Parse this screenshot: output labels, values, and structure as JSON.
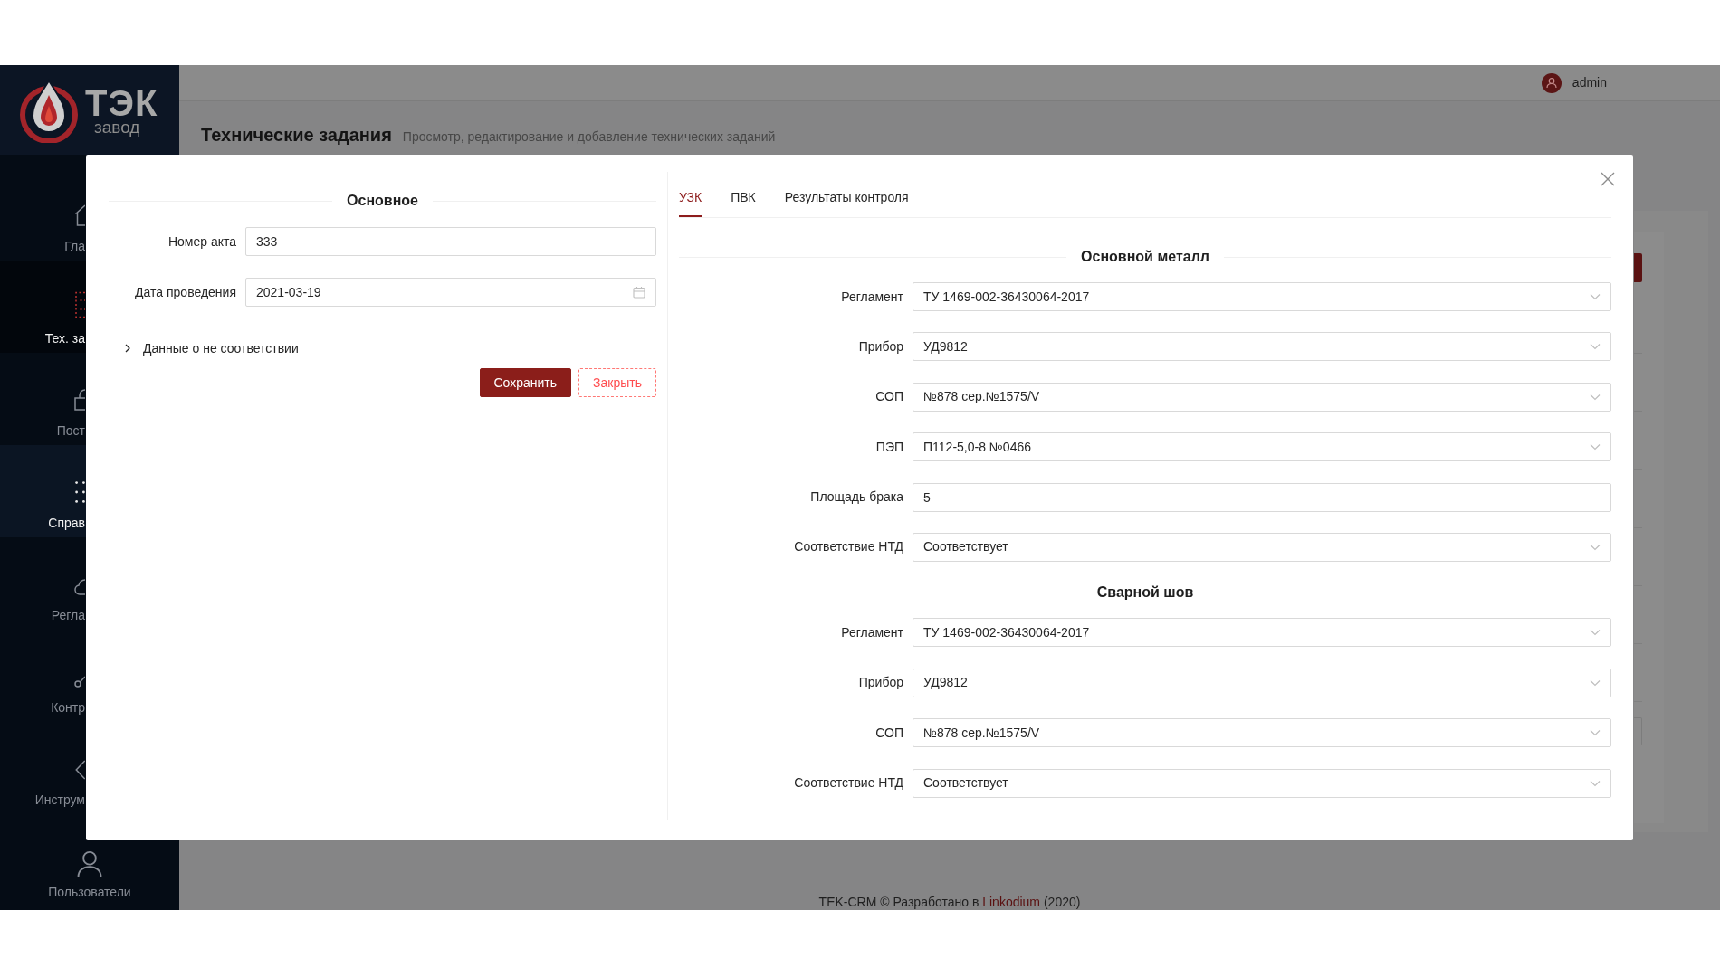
{
  "logo": {
    "title": "ТЭК",
    "subtitle": "завод"
  },
  "sidebar": {
    "items": [
      {
        "label": "Гла",
        "selected": false,
        "hovered": false
      },
      {
        "label": "Тех. за",
        "selected": true,
        "hovered": false
      },
      {
        "label": "Пост",
        "selected": false,
        "hovered": false
      },
      {
        "label": "Справ",
        "selected": false,
        "hovered": true
      },
      {
        "label": "Регла",
        "selected": false,
        "hovered": false
      },
      {
        "label": "Контр",
        "selected": false,
        "hovered": false
      },
      {
        "label": "Инструм",
        "selected": false,
        "hovered": false
      },
      {
        "label": "Пользователи",
        "selected": false,
        "hovered": false
      }
    ]
  },
  "header": {
    "user": "admin"
  },
  "page": {
    "title": "Технические задания",
    "subtitle": "Просмотр, редактирование и добавление технических заданий"
  },
  "modal": {
    "main": {
      "title": "Основное",
      "fields": [
        {
          "kind": "text",
          "label": "Номер акта",
          "value": "333"
        },
        {
          "kind": "date",
          "label": "Дата проведения",
          "value": "2021-03-19"
        }
      ],
      "collapse": {
        "label": "Данные о не соответствии",
        "expanded": false
      },
      "buttons": [
        {
          "kind": "primary",
          "label": "Сохранить"
        },
        {
          "kind": "dashed",
          "label": "Закрыть"
        }
      ]
    },
    "tabs": [
      {
        "label": "УЗК",
        "selected": true
      },
      {
        "label": "ПВК",
        "selected": false
      },
      {
        "label": "Результаты контроля",
        "selected": false
      }
    ],
    "sections": [
      {
        "title": "Основной металл",
        "fields": [
          {
            "kind": "select",
            "label": "Регламент",
            "value": "ТУ 1469-002-36430064-2017"
          },
          {
            "kind": "select",
            "label": "Прибор",
            "value": "УД9812"
          },
          {
            "kind": "select",
            "label": "СОП",
            "value": "№878 сер.№1575/V"
          },
          {
            "kind": "select",
            "label": "ПЭП",
            "value": "П112-5,0-8 №0466"
          },
          {
            "kind": "text",
            "label": "Площадь брака",
            "value": "5"
          },
          {
            "kind": "select",
            "label": "Соответствие НТД",
            "value": "Соответствует"
          }
        ]
      },
      {
        "title": "Сварной шов",
        "fields": [
          {
            "kind": "select",
            "label": "Регламент",
            "value": "ТУ 1469-002-36430064-2017"
          },
          {
            "kind": "select",
            "label": "Прибор",
            "value": "УД9812"
          },
          {
            "kind": "select",
            "label": "СОП",
            "value": "№878 сер.№1575/V"
          },
          {
            "kind": "select",
            "label": "Соответствие НТД",
            "value": "Соответствует"
          }
        ]
      }
    ]
  },
  "footer": {
    "text": "TEK-CRM © Разработано в",
    "link": "Linkodium",
    "suffix": "(2020)"
  }
}
